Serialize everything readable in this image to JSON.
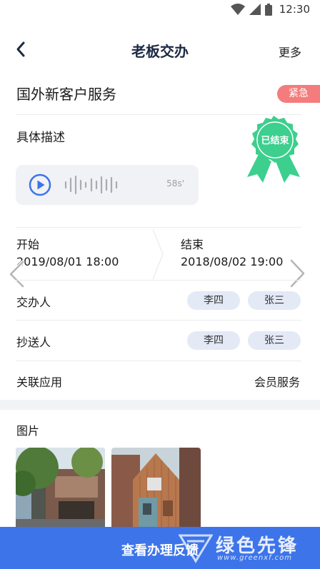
{
  "status_bar": {
    "time": "12:30"
  },
  "header": {
    "title": "老板交办",
    "more_label": "更多"
  },
  "task": {
    "title": "国外新客户服务",
    "priority": "紧急",
    "priority_color": "#f47c7c"
  },
  "description": {
    "label": "具体描述",
    "stamp_text": "已结束",
    "stamp_color": "#3ccf8e",
    "audio": {
      "duration": "58s'"
    }
  },
  "schedule": {
    "start_label": "开始",
    "start_value": "2019/08/01  18:00",
    "end_label": "结束",
    "end_value": "2018/08/02  19:00"
  },
  "assigners": {
    "label": "交办人",
    "people": [
      "李四",
      "张三"
    ]
  },
  "cc": {
    "label": "抄送人",
    "people": [
      "李四",
      "张三"
    ]
  },
  "linked_app": {
    "label": "关联应用",
    "value": "会员服务"
  },
  "images": {
    "label": "图片",
    "count": 2
  },
  "footer": {
    "button_label": "查看办理反馈",
    "accent_color": "#3d74ea"
  },
  "watermark": {
    "text": "绿色先锋",
    "url": "www.greenxf.com"
  }
}
